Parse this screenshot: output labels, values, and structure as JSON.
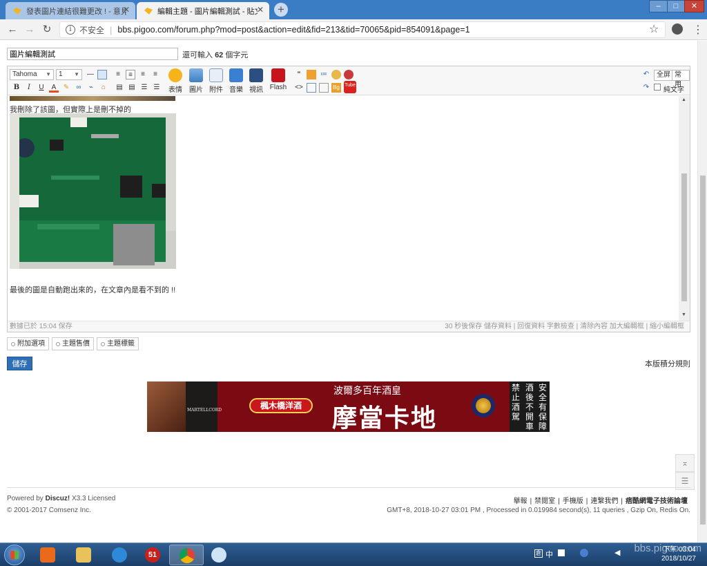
{
  "browser": {
    "tabs": [
      {
        "title": "發表圖片連結很難更改 ! - 意見討",
        "active": false
      },
      {
        "title": "編輯主題 - 圖片編輯測試 - 貼文標",
        "active": true
      }
    ],
    "new_tab": "+",
    "window_controls": {
      "minimize": "–",
      "maximize": "□",
      "close": "✕"
    },
    "insecure_label": "不安全",
    "url": "bbs.pigoo.com/forum.php?mod=post&action=edit&fid=213&tid=70065&pid=854091&page=1"
  },
  "post": {
    "subject": "圖片編輯測試",
    "remaining_prefix": "還可輸入",
    "remaining_count": "62",
    "remaining_suffix": "個字元"
  },
  "editor": {
    "font": "Tahoma",
    "size": "1",
    "big_buttons": [
      "表情",
      "圖片",
      "附件",
      "音樂",
      "視訊",
      "Flash"
    ],
    "right_buttons": {
      "fullscreen": "全屏",
      "common": "常用",
      "plaintext": "純文字"
    },
    "content_line1": "我刪除了該圖，但實際上是刪不掉的",
    "content_line2": "最後的圖是自動跑出來的，在文章內是看不到的 !!",
    "status_left": "數據已於 15:04 保存",
    "status_right": "30 秒後保存 儲存資料 | 回復資料    字數檢查 | 清除內容    加大編輯框 | 縮小編輯框"
  },
  "options": [
    "附加選項",
    "主題售價",
    "主題標籤"
  ],
  "save_label": "儲存",
  "rules_label": "本版積分規則",
  "ad": {
    "bottle_label": "MARTELLCORD",
    "shop": "楓木橋洋酒",
    "line1": "波爾多百年酒皇",
    "line2": "摩當卡地",
    "warning_cols": [
      "禁止酒駕",
      "酒後不開車",
      "安全有保障"
    ]
  },
  "footer": {
    "powered_prefix": "Powered by",
    "powered_brand": "Discuz!",
    "powered_suffix": "X3.3 Licensed",
    "copyright": "© 2001-2017 Comsenz Inc.",
    "links": [
      "舉報",
      "禁閱室",
      "手機版",
      "連繫我們",
      "痞酷網電子技術論壇"
    ],
    "processed": "GMT+8, 2018-10-27 03:01 PM , Processed in 0.019984 second(s), 11 queries , Gzip On, Redis On."
  },
  "taskbar": {
    "tray": "中",
    "clock_time": "下午 03:04",
    "clock_date": "2018/10/27",
    "badge": "51"
  },
  "watermark": "bbs.pigoo.com"
}
